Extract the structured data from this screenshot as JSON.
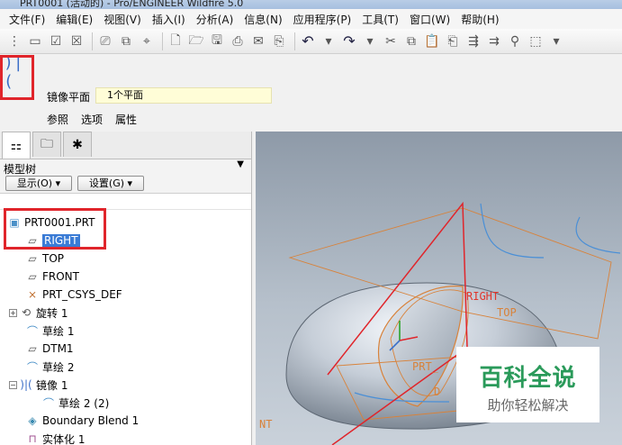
{
  "window": {
    "title": "PRT0001 (活动的) - Pro/ENGINEER Wildfire 5.0"
  },
  "menu": [
    "文件(F)",
    "编辑(E)",
    "视图(V)",
    "插入(I)",
    "分析(A)",
    "信息(N)",
    "应用程序(P)",
    "工具(T)",
    "窗口(W)",
    "帮助(H)"
  ],
  "dashboard": {
    "mirror_plane_label": "镜像平面",
    "mirror_plane_value": "1个平面",
    "tabs": [
      "参照",
      "选项",
      "属性"
    ]
  },
  "model_tree": {
    "title": "模型树",
    "show_button": "显示(O) ▾",
    "settings_button": "设置(G) ▾",
    "items": [
      {
        "label": "PRT0001.PRT",
        "icon": "part-icon"
      },
      {
        "label": "RIGHT",
        "icon": "datum-plane-icon",
        "selected": true
      },
      {
        "label": "TOP",
        "icon": "datum-plane-icon"
      },
      {
        "label": "FRONT",
        "icon": "datum-plane-icon"
      },
      {
        "label": "PRT_CSYS_DEF",
        "icon": "csys-icon"
      },
      {
        "label": "旋转 1",
        "icon": "revolve-icon",
        "expandable": true
      },
      {
        "label": "草绘 1",
        "icon": "sketch-icon"
      },
      {
        "label": "DTM1",
        "icon": "datum-plane-icon"
      },
      {
        "label": "草绘 2",
        "icon": "sketch-icon"
      },
      {
        "label": "镜像 1",
        "icon": "mirror-icon",
        "expanded": true
      },
      {
        "label": "草绘 2 (2)",
        "icon": "sketch-icon"
      },
      {
        "label": "Boundary Blend 1",
        "icon": "blend-icon"
      },
      {
        "label": "实体化 1",
        "icon": "solidify-icon"
      }
    ]
  },
  "graphics": {
    "labels": [
      "RIGHT",
      "TOP",
      "PRT_",
      "D",
      "NT"
    ]
  },
  "watermark": {
    "title": "百科全说",
    "subtitle": "助你轻松解决"
  },
  "colors": {
    "highlight": "#e0252b",
    "selection": "#3a7bd5",
    "datum": "#d8823a",
    "watermark_green": "#2a9a5a"
  }
}
